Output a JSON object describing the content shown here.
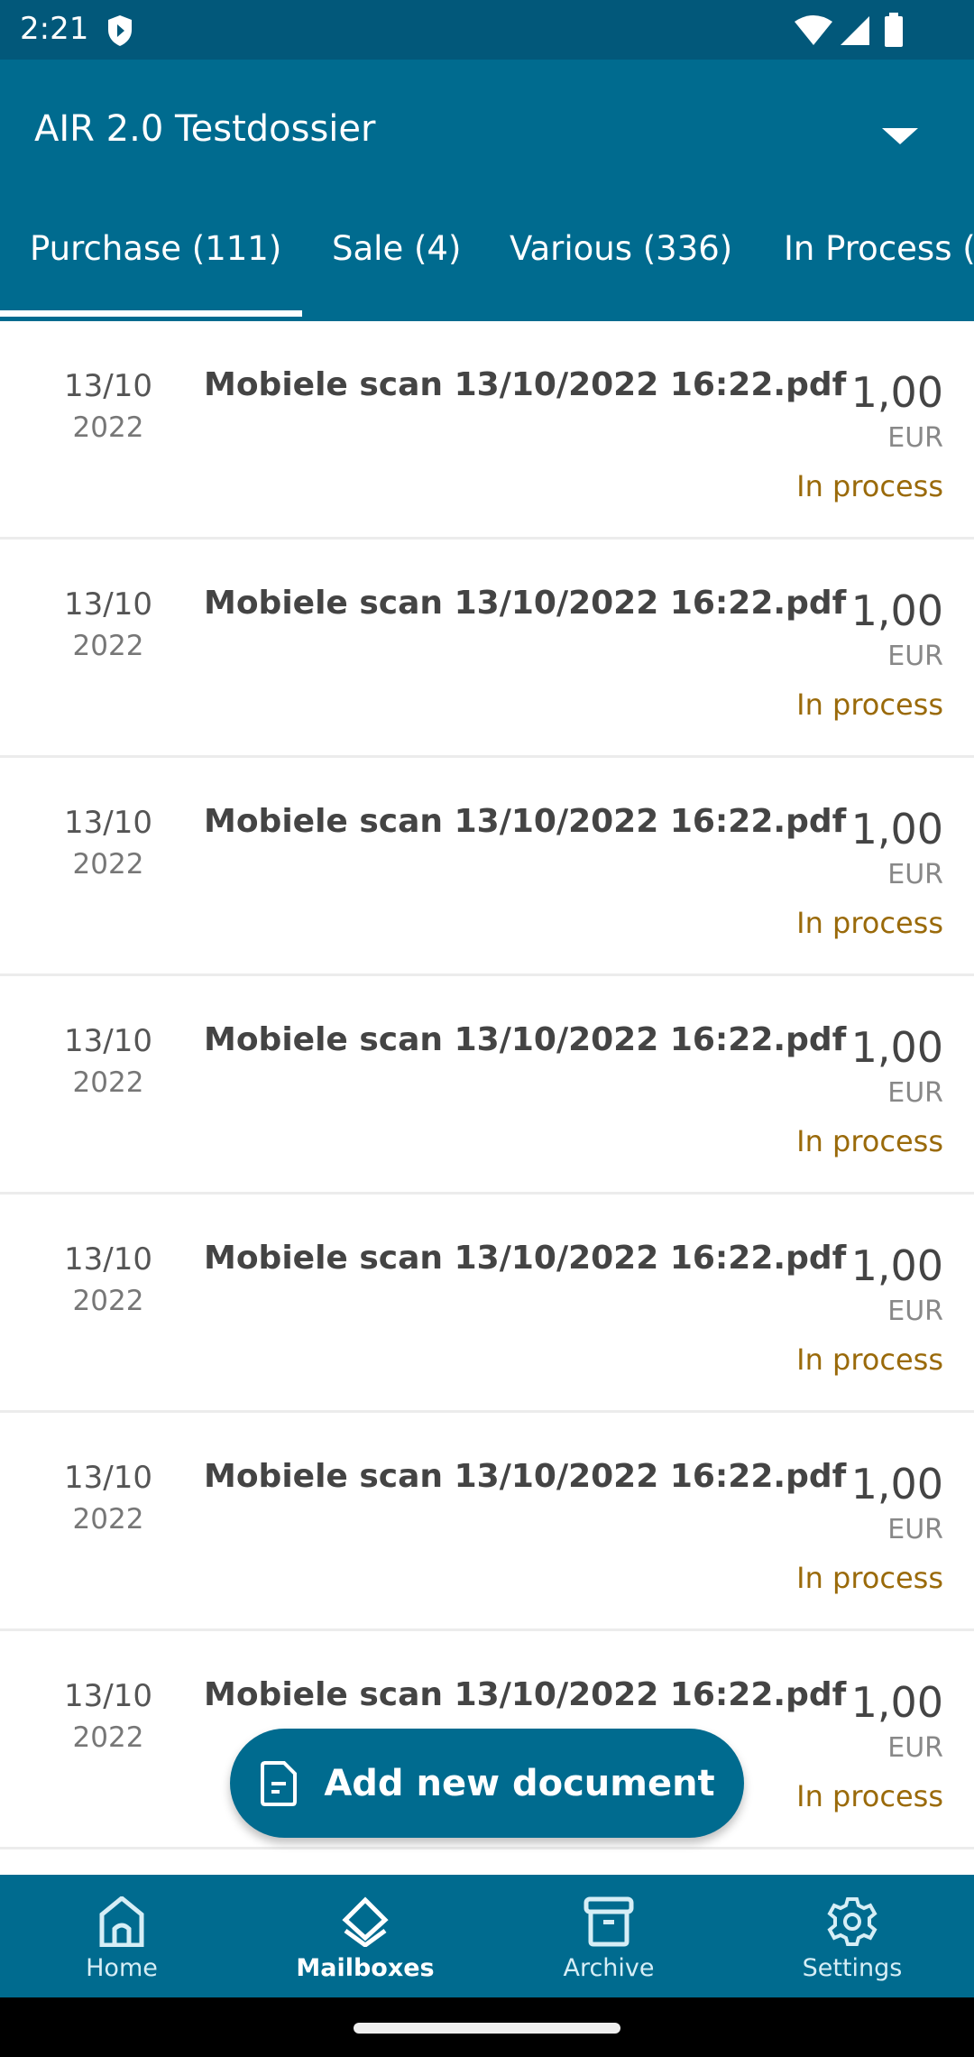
{
  "status_bar": {
    "time": "2:21"
  },
  "header": {
    "title": "AIR 2.0 Testdossier"
  },
  "tabs": [
    {
      "label": "Purchase (111)",
      "active": true
    },
    {
      "label": "Sale (4)"
    },
    {
      "label": "Various (336)"
    },
    {
      "label": "In Process ("
    }
  ],
  "documents": [
    {
      "date": "13/10",
      "year": "2022",
      "name": "Mobiele scan 13/10/2022 16:22.pdf",
      "amount": "1,00",
      "currency": "EUR",
      "status": "In process"
    },
    {
      "date": "13/10",
      "year": "2022",
      "name": "Mobiele scan 13/10/2022 16:22.pdf",
      "amount": "1,00",
      "currency": "EUR",
      "status": "In process"
    },
    {
      "date": "13/10",
      "year": "2022",
      "name": "Mobiele scan 13/10/2022 16:22.pdf",
      "amount": "1,00",
      "currency": "EUR",
      "status": "In process"
    },
    {
      "date": "13/10",
      "year": "2022",
      "name": "Mobiele scan 13/10/2022 16:22.pdf",
      "amount": "1,00",
      "currency": "EUR",
      "status": "In process"
    },
    {
      "date": "13/10",
      "year": "2022",
      "name": "Mobiele scan 13/10/2022 16:22.pdf",
      "amount": "1,00",
      "currency": "EUR",
      "status": "In process"
    },
    {
      "date": "13/10",
      "year": "2022",
      "name": "Mobiele scan 13/10/2022 16:22.pdf",
      "amount": "1,00",
      "currency": "EUR",
      "status": "In process"
    },
    {
      "date": "13/10",
      "year": "2022",
      "name": "Mobiele scan 13/10/2022 16:22.pdf",
      "amount": "1,00",
      "currency": "EUR",
      "status": "In process"
    }
  ],
  "fab": {
    "label": "Add new document",
    "icon": "document-icon"
  },
  "bottom_nav": [
    {
      "label": "Home",
      "icon": "home-icon"
    },
    {
      "label": "Mailboxes",
      "icon": "layers-icon",
      "active": true
    },
    {
      "label": "Archive",
      "icon": "archive-icon"
    },
    {
      "label": "Settings",
      "icon": "gear-icon"
    }
  ],
  "colors": {
    "primary": "#006b8f",
    "status_bar": "#02587a",
    "status_text": "#9a6a0a"
  }
}
